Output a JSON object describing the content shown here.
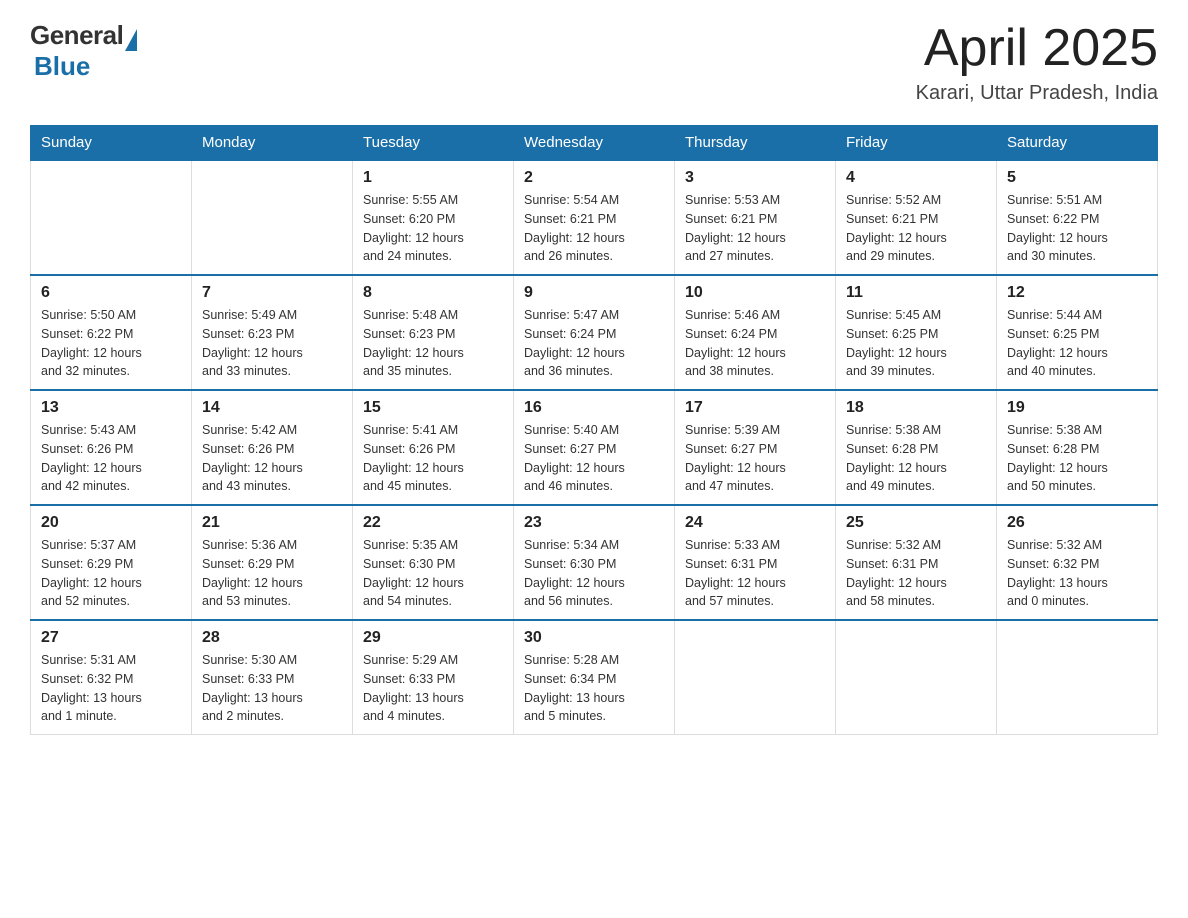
{
  "logo": {
    "general": "General",
    "blue": "Blue",
    "subtitle": "Blue"
  },
  "header": {
    "title": "April 2025",
    "subtitle": "Karari, Uttar Pradesh, India"
  },
  "days_of_week": [
    "Sunday",
    "Monday",
    "Tuesday",
    "Wednesday",
    "Thursday",
    "Friday",
    "Saturday"
  ],
  "weeks": [
    [
      {
        "day": "",
        "info": ""
      },
      {
        "day": "",
        "info": ""
      },
      {
        "day": "1",
        "info": "Sunrise: 5:55 AM\nSunset: 6:20 PM\nDaylight: 12 hours\nand 24 minutes."
      },
      {
        "day": "2",
        "info": "Sunrise: 5:54 AM\nSunset: 6:21 PM\nDaylight: 12 hours\nand 26 minutes."
      },
      {
        "day": "3",
        "info": "Sunrise: 5:53 AM\nSunset: 6:21 PM\nDaylight: 12 hours\nand 27 minutes."
      },
      {
        "day": "4",
        "info": "Sunrise: 5:52 AM\nSunset: 6:21 PM\nDaylight: 12 hours\nand 29 minutes."
      },
      {
        "day": "5",
        "info": "Sunrise: 5:51 AM\nSunset: 6:22 PM\nDaylight: 12 hours\nand 30 minutes."
      }
    ],
    [
      {
        "day": "6",
        "info": "Sunrise: 5:50 AM\nSunset: 6:22 PM\nDaylight: 12 hours\nand 32 minutes."
      },
      {
        "day": "7",
        "info": "Sunrise: 5:49 AM\nSunset: 6:23 PM\nDaylight: 12 hours\nand 33 minutes."
      },
      {
        "day": "8",
        "info": "Sunrise: 5:48 AM\nSunset: 6:23 PM\nDaylight: 12 hours\nand 35 minutes."
      },
      {
        "day": "9",
        "info": "Sunrise: 5:47 AM\nSunset: 6:24 PM\nDaylight: 12 hours\nand 36 minutes."
      },
      {
        "day": "10",
        "info": "Sunrise: 5:46 AM\nSunset: 6:24 PM\nDaylight: 12 hours\nand 38 minutes."
      },
      {
        "day": "11",
        "info": "Sunrise: 5:45 AM\nSunset: 6:25 PM\nDaylight: 12 hours\nand 39 minutes."
      },
      {
        "day": "12",
        "info": "Sunrise: 5:44 AM\nSunset: 6:25 PM\nDaylight: 12 hours\nand 40 minutes."
      }
    ],
    [
      {
        "day": "13",
        "info": "Sunrise: 5:43 AM\nSunset: 6:26 PM\nDaylight: 12 hours\nand 42 minutes."
      },
      {
        "day": "14",
        "info": "Sunrise: 5:42 AM\nSunset: 6:26 PM\nDaylight: 12 hours\nand 43 minutes."
      },
      {
        "day": "15",
        "info": "Sunrise: 5:41 AM\nSunset: 6:26 PM\nDaylight: 12 hours\nand 45 minutes."
      },
      {
        "day": "16",
        "info": "Sunrise: 5:40 AM\nSunset: 6:27 PM\nDaylight: 12 hours\nand 46 minutes."
      },
      {
        "day": "17",
        "info": "Sunrise: 5:39 AM\nSunset: 6:27 PM\nDaylight: 12 hours\nand 47 minutes."
      },
      {
        "day": "18",
        "info": "Sunrise: 5:38 AM\nSunset: 6:28 PM\nDaylight: 12 hours\nand 49 minutes."
      },
      {
        "day": "19",
        "info": "Sunrise: 5:38 AM\nSunset: 6:28 PM\nDaylight: 12 hours\nand 50 minutes."
      }
    ],
    [
      {
        "day": "20",
        "info": "Sunrise: 5:37 AM\nSunset: 6:29 PM\nDaylight: 12 hours\nand 52 minutes."
      },
      {
        "day": "21",
        "info": "Sunrise: 5:36 AM\nSunset: 6:29 PM\nDaylight: 12 hours\nand 53 minutes."
      },
      {
        "day": "22",
        "info": "Sunrise: 5:35 AM\nSunset: 6:30 PM\nDaylight: 12 hours\nand 54 minutes."
      },
      {
        "day": "23",
        "info": "Sunrise: 5:34 AM\nSunset: 6:30 PM\nDaylight: 12 hours\nand 56 minutes."
      },
      {
        "day": "24",
        "info": "Sunrise: 5:33 AM\nSunset: 6:31 PM\nDaylight: 12 hours\nand 57 minutes."
      },
      {
        "day": "25",
        "info": "Sunrise: 5:32 AM\nSunset: 6:31 PM\nDaylight: 12 hours\nand 58 minutes."
      },
      {
        "day": "26",
        "info": "Sunrise: 5:32 AM\nSunset: 6:32 PM\nDaylight: 13 hours\nand 0 minutes."
      }
    ],
    [
      {
        "day": "27",
        "info": "Sunrise: 5:31 AM\nSunset: 6:32 PM\nDaylight: 13 hours\nand 1 minute."
      },
      {
        "day": "28",
        "info": "Sunrise: 5:30 AM\nSunset: 6:33 PM\nDaylight: 13 hours\nand 2 minutes."
      },
      {
        "day": "29",
        "info": "Sunrise: 5:29 AM\nSunset: 6:33 PM\nDaylight: 13 hours\nand 4 minutes."
      },
      {
        "day": "30",
        "info": "Sunrise: 5:28 AM\nSunset: 6:34 PM\nDaylight: 13 hours\nand 5 minutes."
      },
      {
        "day": "",
        "info": ""
      },
      {
        "day": "",
        "info": ""
      },
      {
        "day": "",
        "info": ""
      }
    ]
  ]
}
